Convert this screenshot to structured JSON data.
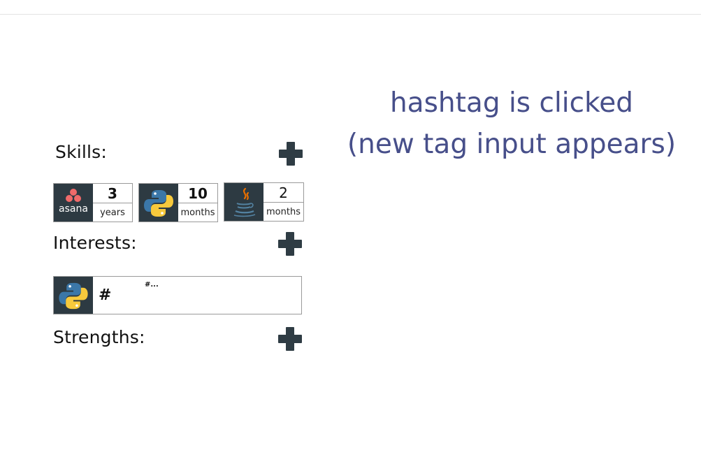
{
  "caption": {
    "line1": "hashtag is clicked",
    "line2": "(new tag input appears)"
  },
  "sections": {
    "skills_label": "Skills:",
    "interests_label": "Interests:",
    "strengths_label": "Strengths:"
  },
  "skills": [
    {
      "logo": "asana-logo",
      "logo_text": "asana",
      "amount": "3",
      "unit": "years"
    },
    {
      "logo": "python-logo",
      "amount": "10",
      "unit": "months"
    },
    {
      "logo": "java-logo",
      "amount": "2",
      "unit": "months"
    }
  ],
  "interests": {
    "logo": "python-logo",
    "hash_symbol": "#",
    "hint": "#..."
  },
  "icons": {
    "add": "plus-icon"
  },
  "colors": {
    "caption": "#474f8a",
    "logo_bg": "#2d3a42",
    "plus": "#2f3c44",
    "asana": "#f06a6a",
    "python_blue": "#3b77a8",
    "python_yellow": "#f7c93c",
    "java_orange": "#e76f00",
    "java_blue": "#5382a1"
  }
}
